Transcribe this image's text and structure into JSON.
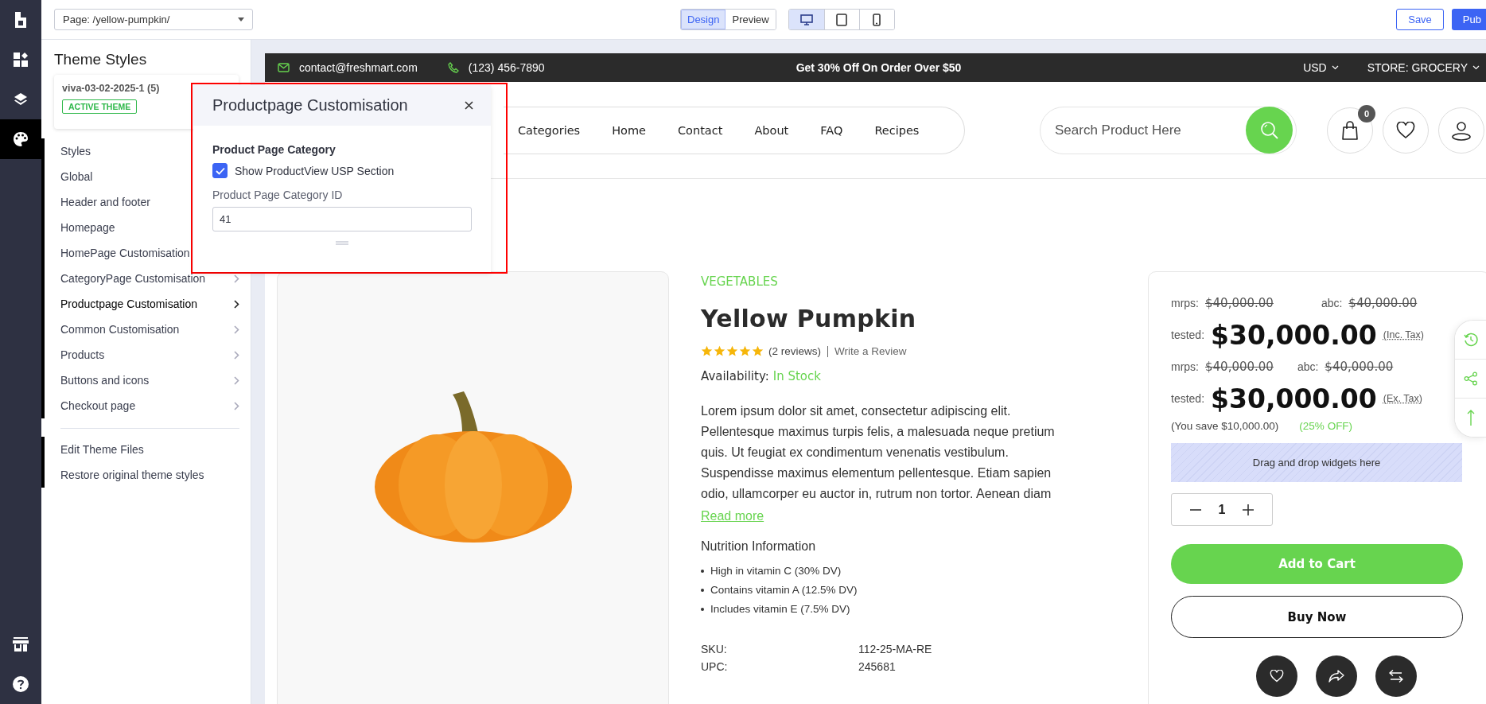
{
  "rail": {
    "top": [
      {
        "kind": "widgets",
        "selected": false
      },
      {
        "kind": "layers",
        "selected": false
      },
      {
        "kind": "palette",
        "selected": true
      }
    ],
    "bottom": [
      {
        "kind": "store"
      },
      {
        "kind": "help"
      }
    ]
  },
  "top_bar": {
    "page_select": "Page: /yellow-pumpkin/",
    "modes": [
      {
        "label": "Design",
        "selected": true
      },
      {
        "label": "Preview",
        "selected": false
      }
    ],
    "devices": [
      {
        "kind": "desktop",
        "selected": true
      },
      {
        "kind": "tablet",
        "selected": false
      },
      {
        "kind": "mobile",
        "selected": false
      }
    ],
    "save": "Save",
    "publish": "Pub"
  },
  "sidebar": {
    "title": "Theme Styles",
    "theme": {
      "name": "viva-03-02-2025-1 (5)",
      "badge": "ACTIVE THEME"
    },
    "items": [
      {
        "label": "Styles",
        "chevron": false,
        "selected": false
      },
      {
        "label": "Global",
        "chevron": false,
        "selected": false
      },
      {
        "label": "Header and footer",
        "chevron": false,
        "selected": false
      },
      {
        "label": "Homepage",
        "chevron": false,
        "selected": false
      },
      {
        "label": "HomePage Customisation",
        "chevron": false,
        "selected": false
      },
      {
        "label": "CategoryPage Customisation",
        "chevron": true,
        "selected": false
      },
      {
        "label": "Productpage Customisation",
        "chevron": true,
        "selected": true
      },
      {
        "label": "Common Customisation",
        "chevron": true,
        "selected": false
      },
      {
        "label": "Products",
        "chevron": true,
        "selected": false
      },
      {
        "label": "Buttons and icons",
        "chevron": true,
        "selected": false
      },
      {
        "label": "Checkout page",
        "chevron": true,
        "selected": false
      }
    ],
    "links": [
      "Edit Theme Files",
      "Restore original theme styles"
    ]
  },
  "popup": {
    "title": "Productpage Customisation",
    "section": "Product Page Category",
    "checkbox": {
      "label": "Show ProductView USP Section",
      "checked": true
    },
    "field": {
      "label": "Product Page Category ID",
      "value": "41"
    }
  },
  "store": {
    "top_strip": {
      "email": "contact@freshmart.com",
      "phone": "(123) 456-7890",
      "promo": "Get 30% Off On Order Over $50",
      "currency": "USD",
      "store": "STORE: GROCERY"
    },
    "nav": [
      "Categories",
      "Home",
      "Contact",
      "About",
      "FAQ",
      "Recipes"
    ],
    "search": {
      "placeholder": "Search Product Here"
    },
    "cart_count": "0"
  },
  "product": {
    "category": "VEGETABLES",
    "title": "Yellow Pumpkin",
    "stars": 5,
    "reviews": "(2 reviews)",
    "write_review": "Write a Review",
    "availability_label": "Availability:",
    "availability": "In Stock",
    "description": "Lorem ipsum dolor sit amet, consectetur adipiscing elit. Pellentesque maximus turpis felis, a malesuada neque pretium quis. Ut feugiat ex condimentum venenatis vestibulum. Suspendisse maximus elementum pellentesque. Etiam sapien odio, ullamcorper eu auctor in, rutrum non tortor. Aenean diam",
    "read_more": "Read more",
    "nutrition_title": "Nutrition Information",
    "nutrition": [
      "High in vitamin C (30% DV)",
      "Contains vitamin A (12.5% DV)",
      "Includes vitamin E (7.5% DV)"
    ],
    "specs": [
      {
        "label": "SKU:",
        "value": "112-25-MA-RE"
      },
      {
        "label": "UPC:",
        "value": "245681"
      }
    ]
  },
  "pricing": {
    "blocks": [
      {
        "was": [
          {
            "label": "mrps:",
            "value": "$40,000.00"
          },
          {
            "label": "abc:",
            "value": "$40,000.00"
          }
        ],
        "price_label": "tested:",
        "price": "$30,000.00",
        "tax": "(Inc. Tax)"
      },
      {
        "was": [
          {
            "label": "mrps:",
            "value": "$40,000.00"
          },
          {
            "label": "abc:",
            "value": "$40,000.00"
          }
        ],
        "price_label": "tested:",
        "price": "$30,000.00",
        "tax": "(Ex. Tax)"
      }
    ],
    "savings": "(You save $10,000.00)",
    "discount": "(25% OFF)",
    "dropzone": "Drag and drop widgets here",
    "quantity": "1",
    "add_to_cart": "Add to Cart",
    "buy_now": "Buy Now"
  }
}
